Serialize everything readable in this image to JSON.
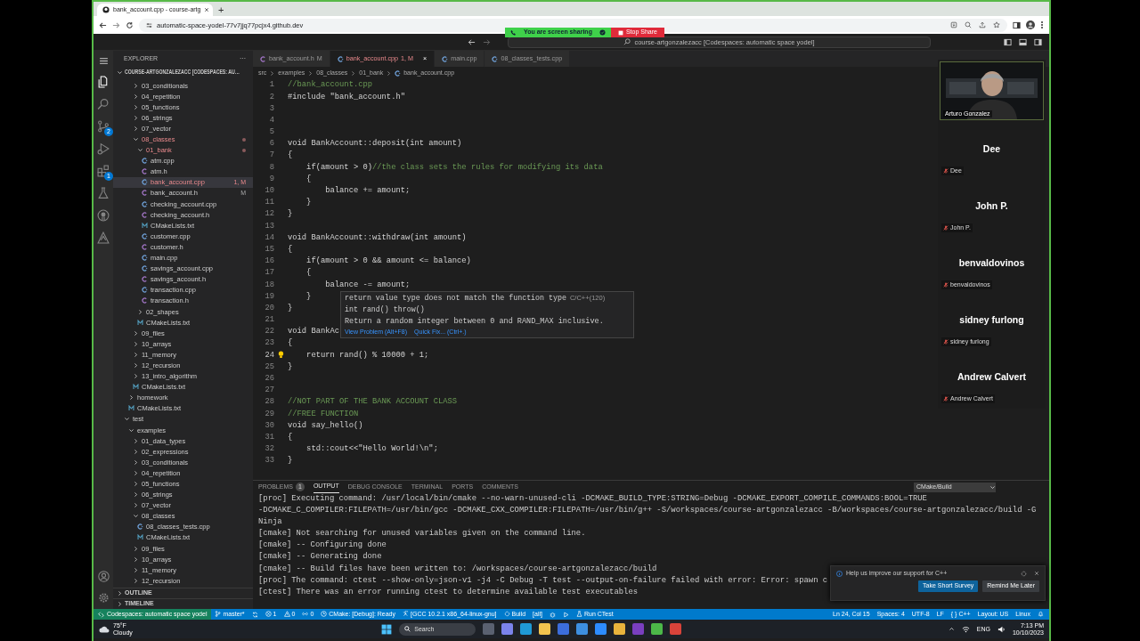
{
  "browser": {
    "tab_title": "bank_account.cpp - course-artg",
    "new_tab": "+",
    "url": "automatic-space-yodel-77v7jjq77pcjx4.github.dev"
  },
  "share_banner": {
    "text": "You are screen sharing",
    "stop": "Stop Share"
  },
  "command_center": "course-artgonzalezacc [Codespaces: automatic space yodel]",
  "activity_bar": [
    {
      "kind": "explorer",
      "selected": true
    },
    {
      "kind": "search",
      "selected": false
    },
    {
      "kind": "source-control",
      "selected": false,
      "badge": "2"
    },
    {
      "kind": "run",
      "selected": false
    },
    {
      "kind": "extensions",
      "selected": false,
      "badge": "1"
    },
    {
      "kind": "testing",
      "selected": false
    },
    {
      "kind": "github",
      "selected": false
    },
    {
      "kind": "cmake",
      "selected": false
    }
  ],
  "explorer": {
    "title": "EXPLORER",
    "more": "···",
    "root": "COURSE-ARTGONZALEZACC [CODESPACES: AU…",
    "outline": "OUTLINE",
    "timeline": "TIMELINE",
    "tree": [
      {
        "children": [
          {
            "children": [
              {
                "children": [
                  {
                    "kind": "folder",
                    "label": "03_conditionals",
                    "expanded": false,
                    "selected": false,
                    "has_problem": false
                  },
                  {
                    "kind": "folder",
                    "label": "04_repetition",
                    "expanded": false,
                    "selected": false,
                    "has_problem": false
                  },
                  {
                    "kind": "folder",
                    "label": "05_functions",
                    "expanded": false,
                    "selected": false,
                    "has_problem": false
                  },
                  {
                    "kind": "folder",
                    "label": "06_strings",
                    "expanded": false,
                    "selected": false,
                    "has_problem": false
                  },
                  {
                    "kind": "folder",
                    "label": "07_vector",
                    "expanded": false,
                    "selected": false,
                    "has_problem": false
                  },
                  {
                    "kind": "folder",
                    "label": "08_classes",
                    "expanded": true,
                    "selected": false,
                    "has_problem": true,
                    "children": [
                      {
                        "kind": "folder",
                        "label": "01_bank",
                        "expanded": true,
                        "selected": false,
                        "has_problem": true,
                        "children": [
                          {
                            "kind": "cpp",
                            "label": "atm.cpp",
                            "selected": false,
                            "has_problem": false
                          },
                          {
                            "kind": "h",
                            "label": "atm.h",
                            "selected": false,
                            "has_problem": false
                          },
                          {
                            "kind": "cpp",
                            "label": "bank_account.cpp",
                            "selected": true,
                            "has_problem": true,
                            "badge": "1, M"
                          },
                          {
                            "kind": "h",
                            "label": "bank_account.h",
                            "selected": false,
                            "has_problem": false,
                            "badge": "M"
                          },
                          {
                            "kind": "cpp",
                            "label": "checking_account.cpp",
                            "selected": false,
                            "has_problem": false
                          },
                          {
                            "kind": "h",
                            "label": "checking_account.h",
                            "selected": false,
                            "has_problem": false
                          },
                          {
                            "kind": "cmake",
                            "label": "CMakeLists.txt",
                            "selected": false,
                            "has_problem": false
                          },
                          {
                            "kind": "cpp",
                            "label": "customer.cpp",
                            "selected": false,
                            "has_problem": false
                          },
                          {
                            "kind": "h",
                            "label": "customer.h",
                            "selected": false,
                            "has_problem": false
                          },
                          {
                            "kind": "cpp",
                            "label": "main.cpp",
                            "selected": false,
                            "has_problem": false
                          },
                          {
                            "kind": "cpp",
                            "label": "savings_account.cpp",
                            "selected": false,
                            "has_problem": false
                          },
                          {
                            "kind": "h",
                            "label": "savings_account.h",
                            "selected": false,
                            "has_problem": false
                          },
                          {
                            "kind": "cpp",
                            "label": "transaction.cpp",
                            "selected": false,
                            "has_problem": false
                          },
                          {
                            "kind": "h",
                            "label": "transaction.h",
                            "selected": false,
                            "has_problem": false
                          }
                        ]
                      },
                      {
                        "kind": "folder",
                        "label": "02_shapes",
                        "expanded": false,
                        "selected": false,
                        "has_problem": false
                      },
                      {
                        "kind": "cmake",
                        "label": "CMakeLists.txt",
                        "selected": false,
                        "has_problem": false
                      }
                    ]
                  },
                  {
                    "kind": "folder",
                    "label": "09_files",
                    "expanded": false,
                    "selected": false,
                    "has_problem": false
                  },
                  {
                    "kind": "folder",
                    "label": "10_arrays",
                    "expanded": false,
                    "selected": false,
                    "has_problem": false
                  },
                  {
                    "kind": "folder",
                    "label": "11_memory",
                    "expanded": false,
                    "selected": false,
                    "has_problem": false
                  },
                  {
                    "kind": "folder",
                    "label": "12_recursion",
                    "expanded": false,
                    "selected": false,
                    "has_problem": false
                  },
                  {
                    "kind": "folder",
                    "label": "13_intro_algorithm",
                    "expanded": false,
                    "selected": false,
                    "has_problem": false
                  },
                  {
                    "kind": "cmake",
                    "label": "CMakeLists.txt",
                    "selected": false,
                    "has_problem": false
                  }
                ]
              },
              {
                "kind": "folder",
                "label": "homework",
                "expanded": false,
                "selected": false,
                "has_problem": false
              },
              {
                "kind": "cmake",
                "label": "CMakeLists.txt",
                "selected": false,
                "has_problem": false
              }
            ]
          },
          {
            "kind": "folder",
            "label": "test",
            "expanded": true,
            "selected": false,
            "has_problem": false,
            "children": [
              {
                "kind": "folder",
                "label": "examples",
                "expanded": true,
                "selected": false,
                "has_problem": false,
                "children": [
                  {
                    "kind": "folder",
                    "label": "01_data_types",
                    "expanded": false,
                    "selected": false,
                    "has_problem": false
                  },
                  {
                    "kind": "folder",
                    "label": "02_expressions",
                    "expanded": false,
                    "selected": false,
                    "has_problem": false
                  },
                  {
                    "kind": "folder",
                    "label": "03_conditionals",
                    "expanded": false,
                    "selected": false,
                    "has_problem": false
                  },
                  {
                    "kind": "folder",
                    "label": "04_repetition",
                    "expanded": false,
                    "selected": false,
                    "has_problem": false
                  },
                  {
                    "kind": "folder",
                    "label": "05_functions",
                    "expanded": false,
                    "selected": false,
                    "has_problem": false
                  },
                  {
                    "kind": "folder",
                    "label": "06_strings",
                    "expanded": false,
                    "selected": false,
                    "has_problem": false
                  },
                  {
                    "kind": "folder",
                    "label": "07_vector",
                    "expanded": false,
                    "selected": false,
                    "has_problem": false
                  },
                  {
                    "kind": "folder",
                    "label": "08_classes",
                    "expanded": true,
                    "selected": false,
                    "has_problem": false,
                    "children": [
                      {
                        "kind": "cpp",
                        "label": "08_classes_tests.cpp",
                        "selected": false,
                        "has_problem": false
                      },
                      {
                        "kind": "cmake",
                        "label": "CMakeLists.txt",
                        "selected": false,
                        "has_problem": false
                      }
                    ]
                  },
                  {
                    "kind": "folder",
                    "label": "09_files",
                    "expanded": false,
                    "selected": false,
                    "has_problem": false
                  },
                  {
                    "kind": "folder",
                    "label": "10_arrays",
                    "expanded": false,
                    "selected": false,
                    "has_problem": false
                  },
                  {
                    "kind": "folder",
                    "label": "11_memory",
                    "expanded": false,
                    "selected": false,
                    "has_problem": false
                  },
                  {
                    "kind": "folder",
                    "label": "12_recursion",
                    "expanded": false,
                    "selected": false,
                    "has_problem": false
                  }
                ]
              }
            ]
          }
        ]
      }
    ]
  },
  "editor_tabs": [
    {
      "kind": "h",
      "label": "bank_account.h",
      "badge": "M",
      "selected": false,
      "has_problem": false
    },
    {
      "kind": "cpp",
      "label": "bank_account.cpp",
      "badge": "1, M",
      "close": "×",
      "selected": true,
      "has_problem": true
    },
    {
      "kind": "cpp",
      "label": "main.cpp",
      "selected": false,
      "has_problem": false
    },
    {
      "kind": "cpp",
      "label": "08_classes_tests.cpp",
      "selected": false,
      "has_problem": false
    }
  ],
  "breadcrumbs": [
    "src",
    "examples",
    "08_classes",
    "01_bank",
    "bank_account.cpp"
  ],
  "code": [
    {
      "n": "1",
      "kind": "plain",
      "comment": "//bank_account.cpp"
    },
    {
      "n": "2",
      "kind": "plain",
      "text": "#include \"bank_account.h\""
    },
    {
      "n": "3",
      "kind": "plain"
    },
    {
      "n": "4",
      "kind": "plain"
    },
    {
      "n": "5",
      "kind": "plain"
    },
    {
      "n": "6",
      "kind": "plain",
      "text": "void BankAccount::deposit(int amount)"
    },
    {
      "n": "7",
      "kind": "plain",
      "text": "{"
    },
    {
      "n": "8",
      "kind": "plain",
      "text": "    if(amount > 0)",
      "comment": "//the class sets the rules for modifying its data"
    },
    {
      "n": "9",
      "kind": "plain",
      "text": "    {"
    },
    {
      "n": "10",
      "kind": "plain",
      "text": "        balance += amount;"
    },
    {
      "n": "11",
      "kind": "plain",
      "text": "    }"
    },
    {
      "n": "12",
      "kind": "plain",
      "text": "}"
    },
    {
      "n": "13",
      "kind": "plain"
    },
    {
      "n": "14",
      "kind": "plain",
      "text": "void BankAccount::withdraw(int amount)"
    },
    {
      "n": "15",
      "kind": "plain",
      "text": "{"
    },
    {
      "n": "16",
      "kind": "plain",
      "text": "    if(amount > 0 && amount <= balance)"
    },
    {
      "n": "17",
      "kind": "plain",
      "text": "    {"
    },
    {
      "n": "18",
      "kind": "plain",
      "text": "        balance -= amount;"
    },
    {
      "n": "19",
      "kind": "plain",
      "text": "    }"
    },
    {
      "n": "20",
      "kind": "plain",
      "text": "}"
    },
    {
      "n": "21",
      "kind": "plain"
    },
    {
      "n": "22",
      "kind": "plain",
      "text": "void BankAc"
    },
    {
      "n": "23",
      "kind": "plain",
      "text": "{"
    },
    {
      "n": "24",
      "kind": "hint",
      "text": "    return rand() % 10000 + 1;"
    },
    {
      "n": "25",
      "kind": "plain",
      "text": "}"
    },
    {
      "n": "26",
      "kind": "plain"
    },
    {
      "n": "27",
      "kind": "plain"
    },
    {
      "n": "28",
      "kind": "plain",
      "comment": "//NOT PART OF THE BANK ACCOUNT CLASS"
    },
    {
      "n": "29",
      "kind": "plain",
      "comment": "//FREE FUNCTION"
    },
    {
      "n": "30",
      "kind": "plain",
      "text": "void say_hello()"
    },
    {
      "n": "31",
      "kind": "plain",
      "text": "{"
    },
    {
      "n": "32",
      "kind": "plain",
      "text": "    std::cout<<\"Hello World!\\n\";"
    },
    {
      "n": "33",
      "kind": "plain",
      "text": "}"
    }
  ],
  "hover": {
    "message": "return value type does not match the function type",
    "source": "C/C++(120)",
    "signature": "int rand() throw()",
    "doc": "Return a random integer between 0 and RAND_MAX inclusive.",
    "actions": [
      "View Problem (Alt+F8)",
      "Quick Fix... (Ctrl+.)"
    ]
  },
  "panel": {
    "tabs": [
      {
        "label": "PROBLEMS",
        "badge": "1",
        "selected": false
      },
      {
        "label": "OUTPUT",
        "selected": true
      },
      {
        "label": "DEBUG CONSOLE",
        "selected": false
      },
      {
        "label": "TERMINAL",
        "selected": false
      },
      {
        "label": "PORTS",
        "selected": false
      },
      {
        "label": "COMMENTS",
        "selected": false
      }
    ],
    "channel": "CMake/Build",
    "lines": [
      "[proc] Executing command: /usr/local/bin/cmake --no-warn-unused-cli -DCMAKE_BUILD_TYPE:STRING=Debug -DCMAKE_EXPORT_COMPILE_COMMANDS:BOOL=TRUE",
      "-DCMAKE_C_COMPILER:FILEPATH=/usr/bin/gcc -DCMAKE_CXX_COMPILER:FILEPATH=/usr/bin/g++ -S/workspaces/course-artgonzalezacc -B/workspaces/course-artgonzalezacc/build -G",
      "Ninja",
      "[cmake] Not searching for unused variables given on the command line.",
      "[cmake] -- Configuring done",
      "[cmake] -- Generating done",
      "[cmake] -- Build files have been written to: /workspaces/course-artgonzalezacc/build",
      "[proc] The command: ctest --show-only=json-v1 -j4 -C Debug -T test --output-on-failure failed with error: Error: spawn c",
      "[ctest] There was an error running ctest to determine available test executables"
    ]
  },
  "notification": {
    "message": "Help us improve our support for C++",
    "buttons": [
      "Take Short Survey",
      "Remind Me Later"
    ]
  },
  "status_bar": {
    "remote": "Codespaces: automatic space yodel",
    "left": [
      {
        "kind": "branch",
        "text": "master*"
      },
      {
        "kind": "sync"
      },
      {
        "kind": "error",
        "text": "1"
      },
      {
        "kind": "warning",
        "text": "0"
      },
      {
        "kind": "ports",
        "text": "0"
      },
      {
        "kind": "cmake",
        "text": "CMake: [Debug]: Ready"
      },
      {
        "kind": "tools",
        "text": "[GCC 10.2.1 x86_64-linux-gnu]"
      },
      {
        "kind": "gear",
        "text": "Build"
      },
      {
        "kind": "plain",
        "text": "[all]"
      },
      {
        "kind": "bug"
      },
      {
        "kind": "play"
      },
      {
        "kind": "beaker",
        "text": "Run CTest"
      }
    ],
    "right": [
      "Ln 24, Col 15",
      "Spaces: 4",
      "UTF-8",
      "LF",
      "{ } C++",
      "Layout: US",
      "Linux"
    ]
  },
  "meeting": {
    "presenter": "Arturo Gonzalez",
    "participants": [
      {
        "tile_name": "Dee",
        "label": "Dee",
        "muted": true
      },
      {
        "tile_name": "John P.",
        "label": "John P.",
        "muted": true
      },
      {
        "tile_name": "benvaldovinos",
        "label": "benvaldovinos",
        "muted": true
      },
      {
        "tile_name": "sidney furlong",
        "label": "sidney furlong",
        "muted": true
      },
      {
        "tile_name": "Andrew Calvert",
        "label": "Andrew Calvert",
        "muted": true
      }
    ]
  },
  "taskbar": {
    "temperature": "75°F",
    "condition": "Cloudy",
    "search": "Search",
    "apps": [
      {
        "kind": "task-view"
      },
      {
        "kind": "video-chat"
      },
      {
        "kind": "browser"
      },
      {
        "kind": "folder"
      },
      {
        "kind": "store"
      },
      {
        "kind": "mail"
      },
      {
        "kind": "video-call"
      },
      {
        "kind": "chrome"
      },
      {
        "kind": "notes"
      },
      {
        "kind": "green-app"
      },
      {
        "kind": "red-app"
      }
    ],
    "language": "ENG",
    "time": "7:13 PM",
    "date": "10/10/2023"
  }
}
